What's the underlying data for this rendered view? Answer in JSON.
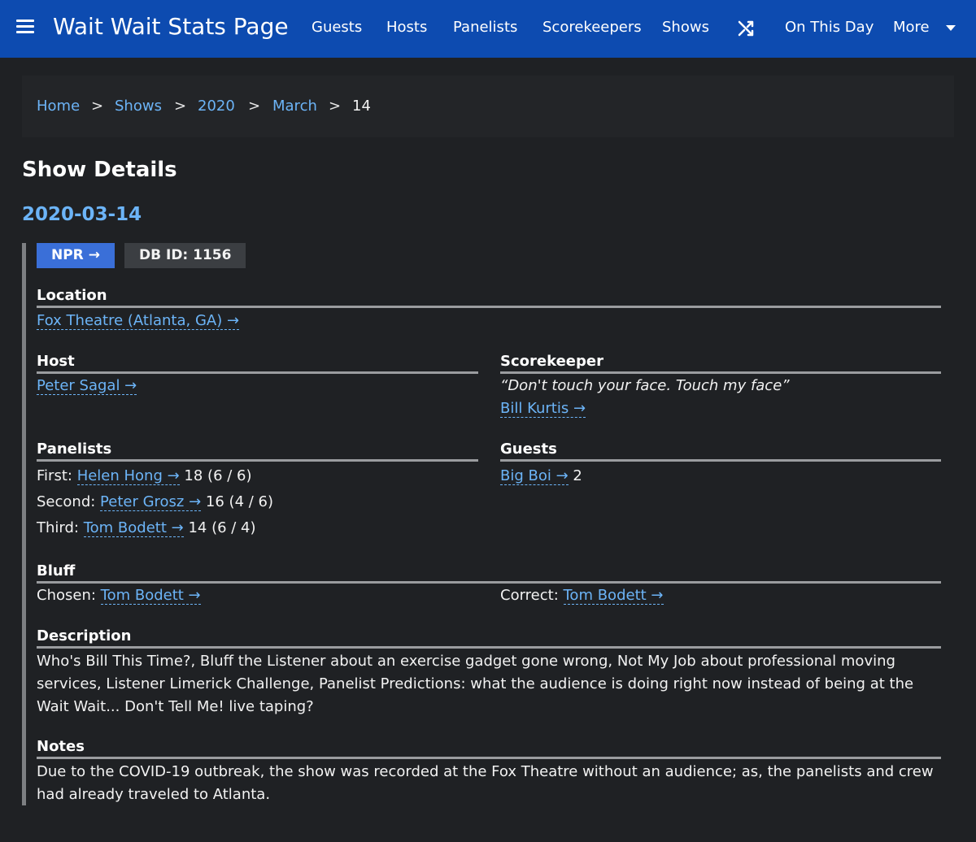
{
  "nav": {
    "brand": "Wait Wait Stats Page",
    "items": [
      "Guests",
      "Hosts",
      "Panelists",
      "Scorekeepers",
      "Shows"
    ],
    "on_this_day": "On This Day",
    "more": "More"
  },
  "breadcrumb": {
    "home": "Home",
    "shows": "Shows",
    "year": "2020",
    "month": "March",
    "day": "14",
    "separator": ">"
  },
  "page_title": "Show Details",
  "show_date": "2020-03-14",
  "badges": {
    "npr": "NPR →",
    "db_id": "DB ID: 1156"
  },
  "location": {
    "label": "Location",
    "value": "Fox Theatre (Atlanta, GA) →"
  },
  "host": {
    "label": "Host",
    "value": "Peter Sagal →"
  },
  "scorekeeper": {
    "label": "Scorekeeper",
    "quote": "“Don't touch your face. Touch my face”",
    "value": "Bill Kurtis →"
  },
  "panelists": {
    "label": "Panelists",
    "rows": [
      {
        "position": "First:",
        "name": "Helen Hong →",
        "score": "18 (6 / 6)"
      },
      {
        "position": "Second:",
        "name": "Peter Grosz →",
        "score": "16 (4 / 6)"
      },
      {
        "position": "Third:",
        "name": "Tom Bodett →",
        "score": "14 (6 / 4)"
      }
    ]
  },
  "guests": {
    "label": "Guests",
    "name": "Big Boi →",
    "score": "2"
  },
  "bluff": {
    "label": "Bluff",
    "chosen_label": "Chosen:",
    "chosen": "Tom Bodett →",
    "correct_label": "Correct:",
    "correct": "Tom Bodett →"
  },
  "description": {
    "label": "Description",
    "text": "Who's Bill This Time?, Bluff the Listener about an exercise gadget gone wrong, Not My Job about professional moving services, Listener Limerick Challenge, Panelist Predictions: what the audience is doing right now instead of being at the Wait Wait... Don't Tell Me! live taping?"
  },
  "notes": {
    "label": "Notes",
    "text": "Due to the COVID-19 outbreak, the show was recorded at the Fox Theatre without an audience; as, the panelists and crew had already traveled to Atlanta."
  }
}
